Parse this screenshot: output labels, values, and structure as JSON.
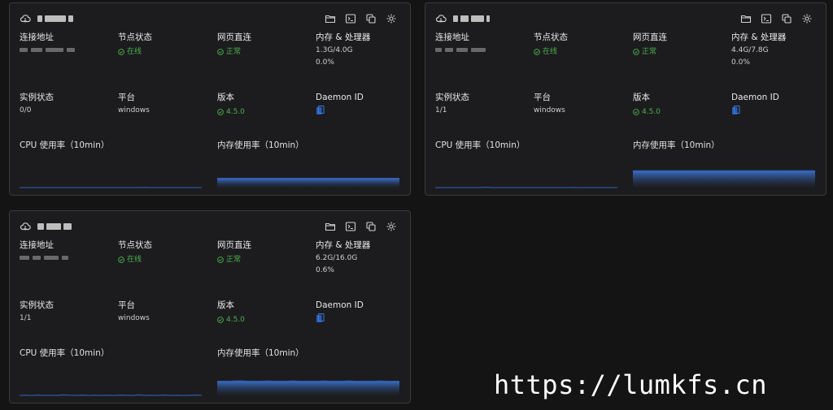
{
  "labels": {
    "address": "连接地址",
    "node_status": "节点状态",
    "web_direct": "网页直连",
    "mem_cpu": "内存 & 处理器",
    "instance_status": "实例状态",
    "platform": "平台",
    "version": "版本",
    "daemon_id": "Daemon ID",
    "cpu_chart": "CPU 使用率（10min）",
    "mem_chart": "内存使用率（10min）"
  },
  "icons": {
    "node": "cloud-icon",
    "actions": [
      "folder-icon",
      "terminal-icon",
      "copy-icon",
      "gear-icon"
    ],
    "daemon": "copy-id-icon",
    "status": "check-circle-icon"
  },
  "colors": {
    "status_ok": "#4caf50",
    "chart_blue": "#2f5dab",
    "daemon_icon": "#3b7ddd"
  },
  "nodes": [
    {
      "node_status": "在线",
      "web_direct": "正常",
      "memory": "1.3G/4.0G",
      "cpu": "0.0%",
      "instances": "0/0",
      "platform": "windows",
      "version": "4.5.0",
      "cpu_usage": [
        0,
        0,
        0,
        0,
        0,
        0,
        0,
        0,
        0,
        0,
        0,
        0,
        0,
        0,
        0,
        0,
        0,
        0,
        0,
        0,
        0.5,
        0,
        0,
        0,
        0,
        0,
        0,
        0,
        0,
        0
      ],
      "mem_usage": [
        25,
        25,
        25,
        25,
        25,
        25,
        25,
        25,
        25,
        25,
        25,
        25,
        25,
        25,
        25,
        25,
        25,
        25,
        25,
        25,
        25,
        25,
        25,
        25,
        25,
        25,
        25,
        25,
        25,
        25
      ]
    },
    {
      "node_status": "在线",
      "web_direct": "正常",
      "memory": "4.4G/7.8G",
      "cpu": "0.0%",
      "instances": "1/1",
      "platform": "windows",
      "version": "4.5.0",
      "cpu_usage": [
        0,
        0,
        0,
        0,
        0,
        0,
        0,
        0,
        1,
        0,
        0,
        0,
        0,
        0,
        0,
        0,
        0,
        0,
        0,
        0,
        0,
        0,
        0.5,
        0,
        0,
        0,
        0,
        0,
        0,
        0
      ],
      "mem_usage": [
        45,
        45,
        45,
        45,
        45,
        45,
        45,
        45,
        45,
        45,
        45,
        45,
        45,
        45,
        45,
        45,
        45,
        45,
        45,
        45,
        45,
        45,
        45,
        45,
        45,
        45,
        45,
        45,
        45,
        45
      ]
    },
    {
      "node_status": "在线",
      "web_direct": "正常",
      "memory": "6.2G/16.0G",
      "cpu": "0.6%",
      "instances": "1/1",
      "platform": "windows",
      "version": "4.5.0",
      "cpu_usage": [
        0,
        0.5,
        0,
        1,
        0,
        0.5,
        0,
        2,
        0.5,
        0,
        1,
        0,
        0.5,
        0,
        0.5,
        0,
        1,
        0.5,
        0,
        2,
        0,
        0.5,
        0,
        1,
        0,
        0.5,
        0,
        0.5,
        1,
        0
      ],
      "mem_usage": [
        38,
        38,
        38,
        39,
        39,
        38,
        38,
        38,
        39,
        38,
        38,
        38,
        39,
        38,
        38,
        38,
        38,
        39,
        38,
        38,
        38,
        39,
        38,
        38,
        38,
        38,
        39,
        38,
        38,
        38
      ]
    }
  ],
  "watermark": "https://lumkfs.cn"
}
